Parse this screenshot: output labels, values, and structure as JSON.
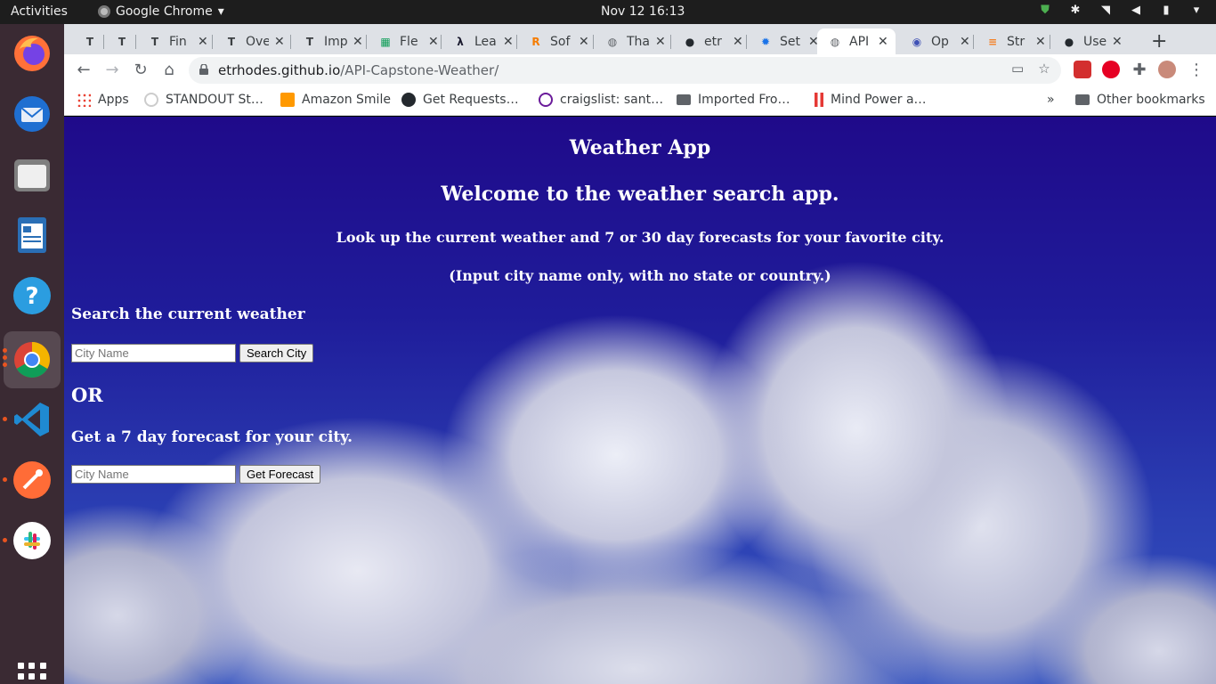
{
  "system": {
    "activities_label": "Activities",
    "app_name": "Google Chrome",
    "clock": "Nov 12  16:13"
  },
  "dock": {
    "apps": [
      "firefox-icon",
      "thunderbird-icon",
      "files-icon",
      "writer-icon",
      "help-icon",
      "chrome-icon",
      "vscode-icon",
      "postman-icon",
      "slack-icon"
    ],
    "show_apps_icon": "apps-grid-icon"
  },
  "browser": {
    "tabs": [
      {
        "title": "",
        "icon": "typora-icon"
      },
      {
        "title": "",
        "icon": "typora-icon"
      },
      {
        "title": "Fin",
        "icon": "typora-icon"
      },
      {
        "title": "Ove",
        "icon": "typora-icon"
      },
      {
        "title": "Imp",
        "icon": "typora-icon"
      },
      {
        "title": "Fle",
        "icon": "sheets-icon"
      },
      {
        "title": "Lea",
        "icon": "lambda-icon"
      },
      {
        "title": "Sof",
        "icon": "r-icon"
      },
      {
        "title": "Tha",
        "icon": "globe-icon"
      },
      {
        "title": "etr",
        "icon": "github-icon"
      },
      {
        "title": "Set",
        "icon": "gear-icon"
      },
      {
        "title": "API",
        "icon": "globe-icon",
        "active": true
      },
      {
        "title": "Op",
        "icon": "octo-icon"
      },
      {
        "title": "Str",
        "icon": "stackoverflow-icon"
      },
      {
        "title": "Use",
        "icon": "github-icon"
      }
    ],
    "address": {
      "host": "etrhodes.github.io",
      "path": "/API-Capstone-Weather/"
    },
    "bookmarks": [
      {
        "label": "Apps",
        "icon": "apps-icon"
      },
      {
        "label": "STANDOUT St…",
        "icon": "standout-icon"
      },
      {
        "label": "Amazon Smile",
        "icon": "amazon-icon"
      },
      {
        "label": "Get Requests…",
        "icon": "github-icon"
      },
      {
        "label": "craigslist: sant…",
        "icon": "peace-icon"
      },
      {
        "label": "Imported Fro…",
        "icon": "folder-icon"
      },
      {
        "label": "Mind Power a…",
        "icon": "bookmark-icon"
      }
    ],
    "overflow_label": "»",
    "other_bookmarks": "Other bookmarks"
  },
  "page": {
    "title": "Weather App",
    "welcome": "Welcome to the weather search app.",
    "intro": "Look up the current weather and 7 or 30 day forecasts for your favorite city.",
    "note": "(Input city name only, with no state or country.)",
    "current_heading": "Search the current weather",
    "current_placeholder": "City Name",
    "current_button": "Search City",
    "or_label": "OR",
    "forecast_heading": "Get a 7 day forecast for your city.",
    "forecast_placeholder": "City Name",
    "forecast_button": "Get Forecast"
  }
}
